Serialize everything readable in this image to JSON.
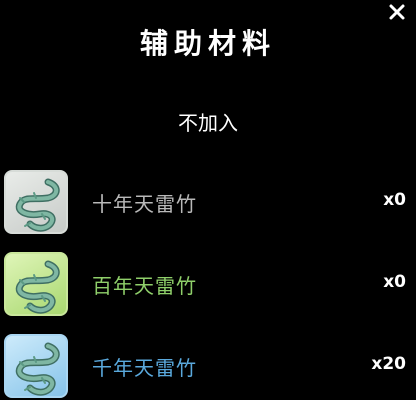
{
  "dialog": {
    "title": "辅助材料",
    "close_icon": "close-icon",
    "none_option": "不加入"
  },
  "colors": {
    "background": "#000000",
    "common": "#b9b9b9",
    "uncommon": "#8fcf6a",
    "rare": "#5aa9dd"
  },
  "items": [
    {
      "name": "十年天雷竹",
      "count": "x0",
      "icon": "thunder-bamboo-icon",
      "quality": "common"
    },
    {
      "name": "百年天雷竹",
      "count": "x0",
      "icon": "thunder-bamboo-icon",
      "quality": "uncommon"
    },
    {
      "name": "千年天雷竹",
      "count": "x20",
      "icon": "thunder-bamboo-icon",
      "quality": "rare"
    }
  ]
}
